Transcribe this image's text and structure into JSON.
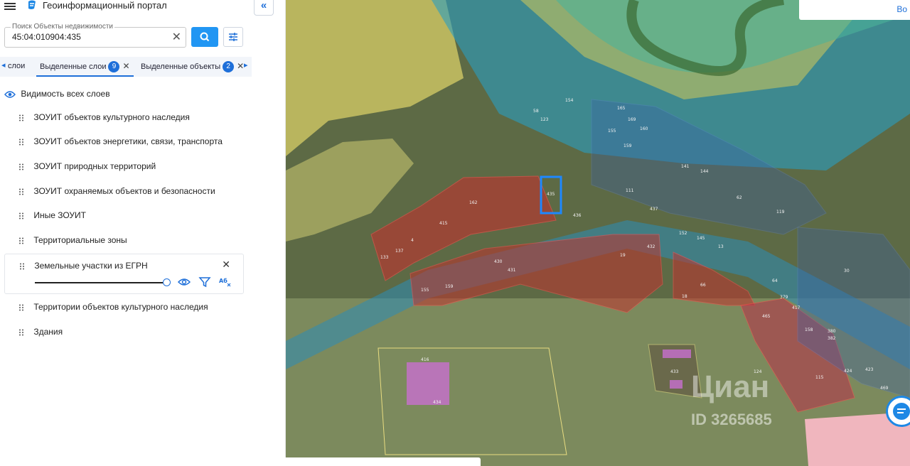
{
  "header": {
    "title": "Геоинформационный портал",
    "collapse_icon": "double-chevron-left-icon"
  },
  "search": {
    "label": "Поиск Объекты недвижимости",
    "value": "45:04:010904:435"
  },
  "tabs": [
    {
      "label": "слои"
    },
    {
      "label": "Выделенные слои",
      "count": "9"
    },
    {
      "label": "Выделенные объекты",
      "count": "2"
    }
  ],
  "visibility_label": "Видимость всех слоев",
  "layers": [
    "ЗОУИТ объектов культурного наследия",
    "ЗОУИТ объектов энергетики, связи, транспорта",
    "ЗОУИТ природных территорий",
    "ЗОУИТ охраняемых объектов и безопасности",
    "Иные ЗОУИТ",
    "Территориальные зоны",
    "Земельные участки из ЕГРН",
    "Территории объектов культурного наследия",
    "Здания"
  ],
  "map": {
    "popup_text": "Во",
    "watermark": "Циан",
    "watermark_id": "ID 3265685",
    "plot_labels": [
      "435",
      "436",
      "437",
      "162",
      "415",
      "137",
      "133",
      "4",
      "155",
      "159",
      "430",
      "431",
      "19",
      "432",
      "152",
      "145",
      "13",
      "62",
      "119",
      "66",
      "18",
      "64",
      "379",
      "417",
      "158",
      "380",
      "382",
      "424",
      "423",
      "469",
      "465",
      "115",
      "124",
      "433",
      "416",
      "434",
      "58",
      "123",
      "154",
      "165",
      "169",
      "155",
      "160",
      "159",
      "141",
      "144",
      "111",
      "30"
    ]
  },
  "colors": {
    "accent": "#1e6fd9",
    "search_button": "#2196f3"
  }
}
